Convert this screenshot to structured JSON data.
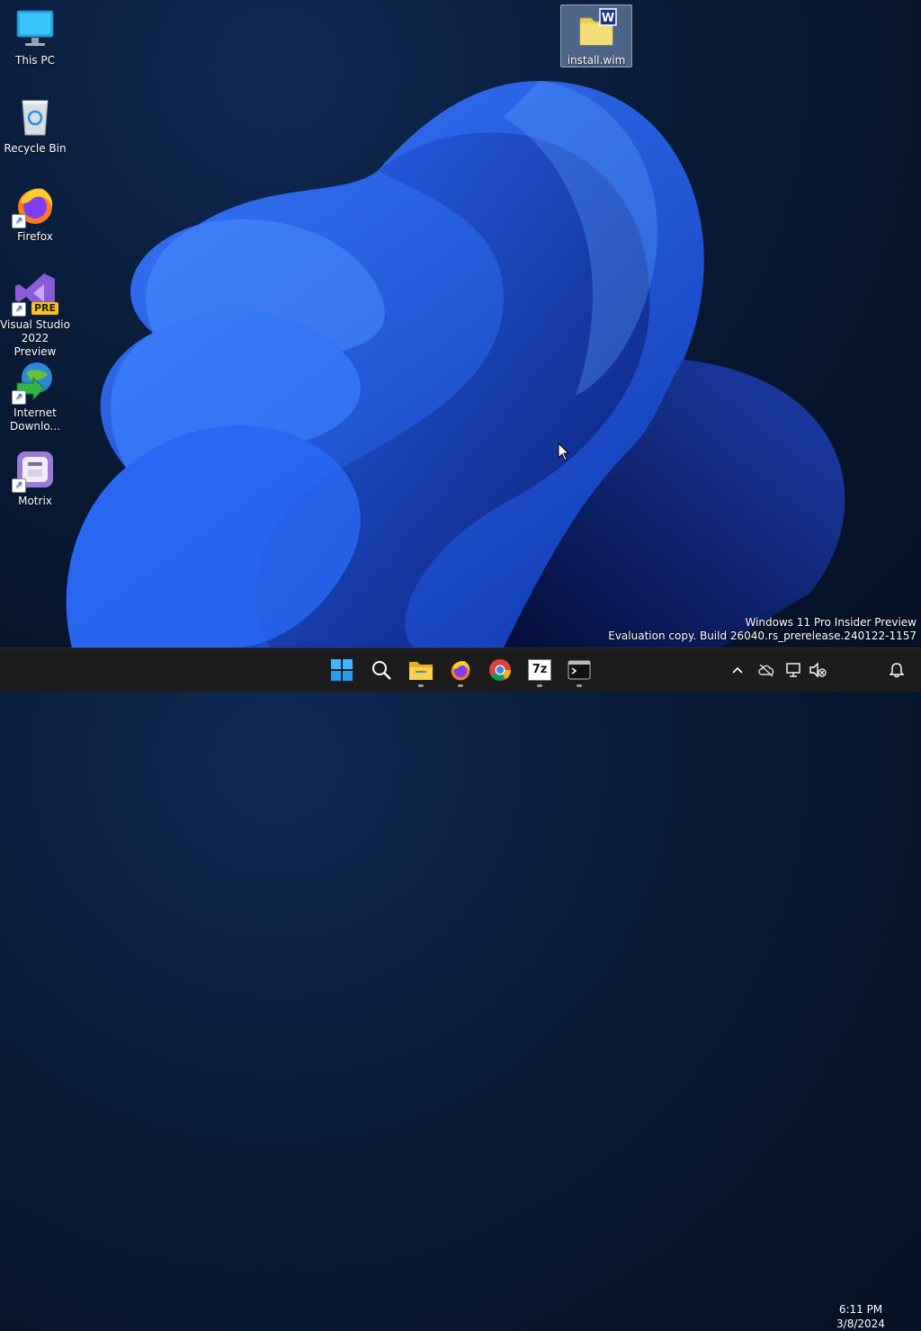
{
  "desktop": {
    "icons": [
      {
        "label": "This PC"
      },
      {
        "label": "Recycle Bin"
      },
      {
        "label": "Firefox"
      },
      {
        "label": "Visual Studio 2022 Preview",
        "badge": "PRE"
      },
      {
        "label": "Internet Downlo..."
      },
      {
        "label": "Motrix"
      },
      {
        "label": "install.wim",
        "selected": true
      }
    ]
  },
  "watermark": {
    "line1": "Windows 11 Pro Insider Preview",
    "line2": "Evaluation copy. Build 26040.rs_prerelease.240122-1157"
  },
  "taskbar": {
    "apps": [
      {
        "icon": "windows-start-icon",
        "running": false
      },
      {
        "icon": "search-icon",
        "running": false
      },
      {
        "icon": "file-explorer-icon",
        "running": true
      },
      {
        "icon": "firefox-icon",
        "running": true
      },
      {
        "icon": "chrome-icon",
        "running": false
      },
      {
        "icon": "7zip-icon",
        "label": "7z",
        "running": true
      },
      {
        "icon": "terminal-icon",
        "running": true
      }
    ],
    "tray": {
      "icons": [
        "chevron-up-icon",
        "onedrive-offline-icon",
        "network-icon",
        "volume-muted-icon"
      ],
      "time": "6:11 PM",
      "date": "3/8/2024",
      "notification_icon": "bell-icon"
    }
  },
  "colors": {
    "wallpaper_primary": "#1a4fe0",
    "wallpaper_dark": "#081a36",
    "taskbar_bg": "#1c1c1c",
    "selection": "#a0bee6"
  }
}
